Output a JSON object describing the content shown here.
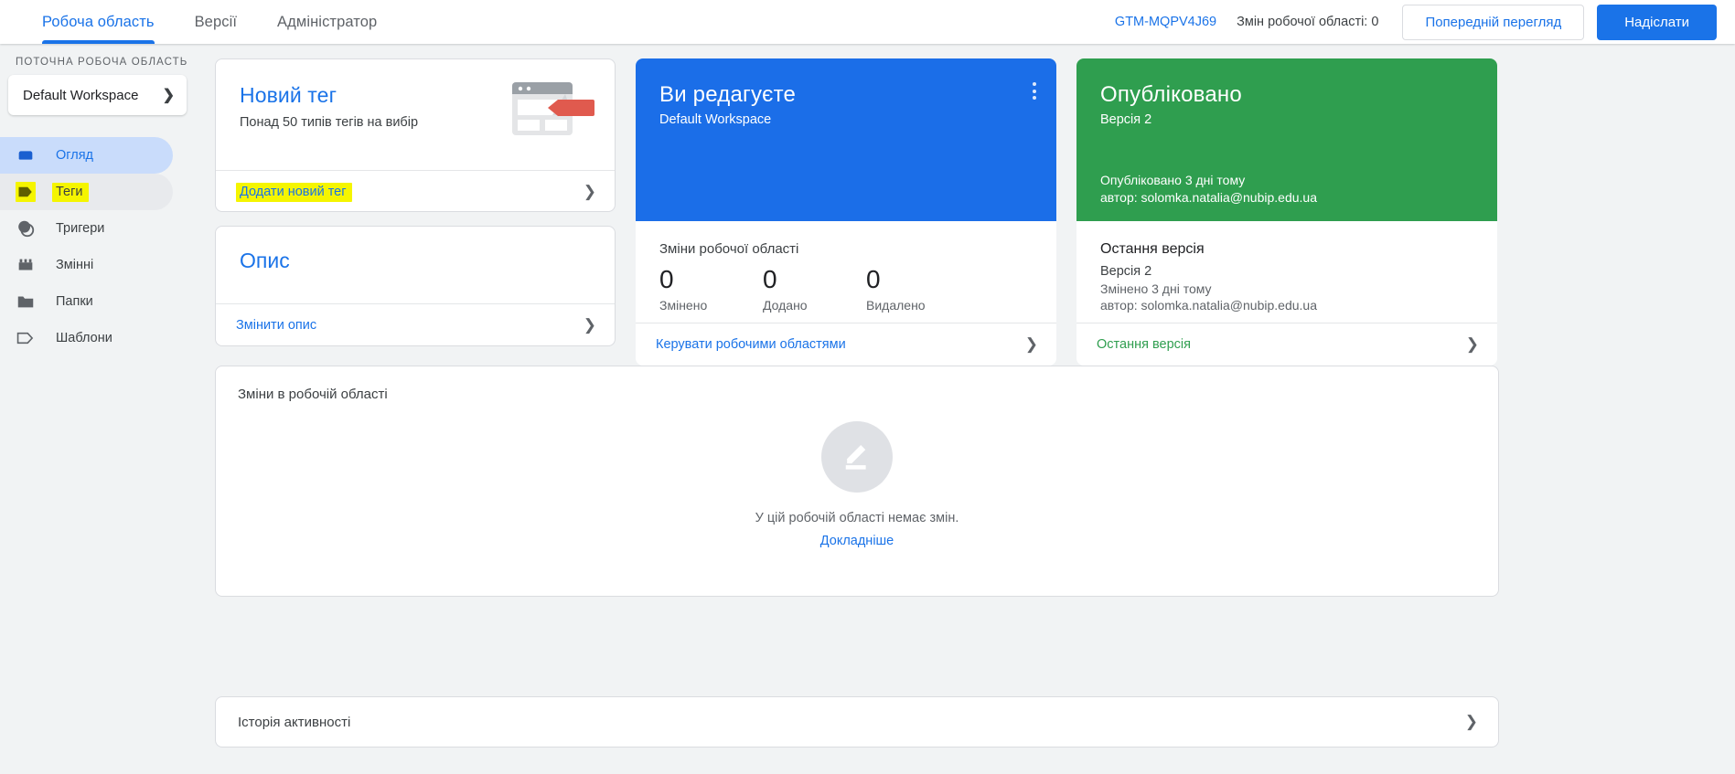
{
  "header": {
    "tabs": [
      {
        "label": "Робоча область",
        "active": true
      },
      {
        "label": "Версії",
        "active": false
      },
      {
        "label": "Адміністратор",
        "active": false
      }
    ],
    "container_id": "GTM-MQPV4J69",
    "workspace_changes": "Змін робочої області: 0",
    "preview_button": "Попередній перегляд",
    "submit_button": "Надіслати"
  },
  "sidebar": {
    "section_label": "ПОТОЧНА РОБОЧА ОБЛАСТЬ",
    "workspace_name": "Default Workspace",
    "items": [
      {
        "label": "Огляд",
        "icon": "overview-icon"
      },
      {
        "label": "Теги",
        "icon": "tag-icon"
      },
      {
        "label": "Тригери",
        "icon": "trigger-icon"
      },
      {
        "label": "Змінні",
        "icon": "variable-icon"
      },
      {
        "label": "Папки",
        "icon": "folder-icon"
      },
      {
        "label": "Шаблони",
        "icon": "template-icon"
      }
    ]
  },
  "new_tag_card": {
    "title": "Новий тег",
    "subtitle": "Понад 50 типів тегів на вибір",
    "action": "Додати новий тег"
  },
  "description_card": {
    "title": "Опис",
    "action": "Змінити опис"
  },
  "editing_card": {
    "title": "Ви редагуєте",
    "subtitle": "Default Workspace",
    "stats_title": "Зміни робочої області",
    "stats": [
      {
        "value": "0",
        "label": "Змінено"
      },
      {
        "value": "0",
        "label": "Додано"
      },
      {
        "value": "0",
        "label": "Видалено"
      }
    ],
    "action": "Керувати робочими областями"
  },
  "published_card": {
    "title": "Опубліковано",
    "subtitle": "Версія 2",
    "published_when": "Опубліковано 3 дні тому",
    "published_by": "автор: solomka.natalia@nubip.edu.ua",
    "latest_title": "Остання версія",
    "latest_version": "Версія 2",
    "latest_changed": "Змінено 3 дні тому",
    "latest_author": "автор: solomka.natalia@nubip.edu.ua",
    "action": "Остання версія"
  },
  "changes_panel": {
    "title": "Зміни в робочій області",
    "empty_text": "У цій робочій області немає змін.",
    "empty_link": "Докладніше"
  },
  "activity_row": {
    "title": "Історія активності"
  },
  "colors": {
    "accent_blue": "#1a73e8",
    "card_blue": "#1b6ee8",
    "card_green": "#2f9e4f",
    "highlight_yellow": "#f5f500",
    "page_bg": "#f1f3f4"
  }
}
